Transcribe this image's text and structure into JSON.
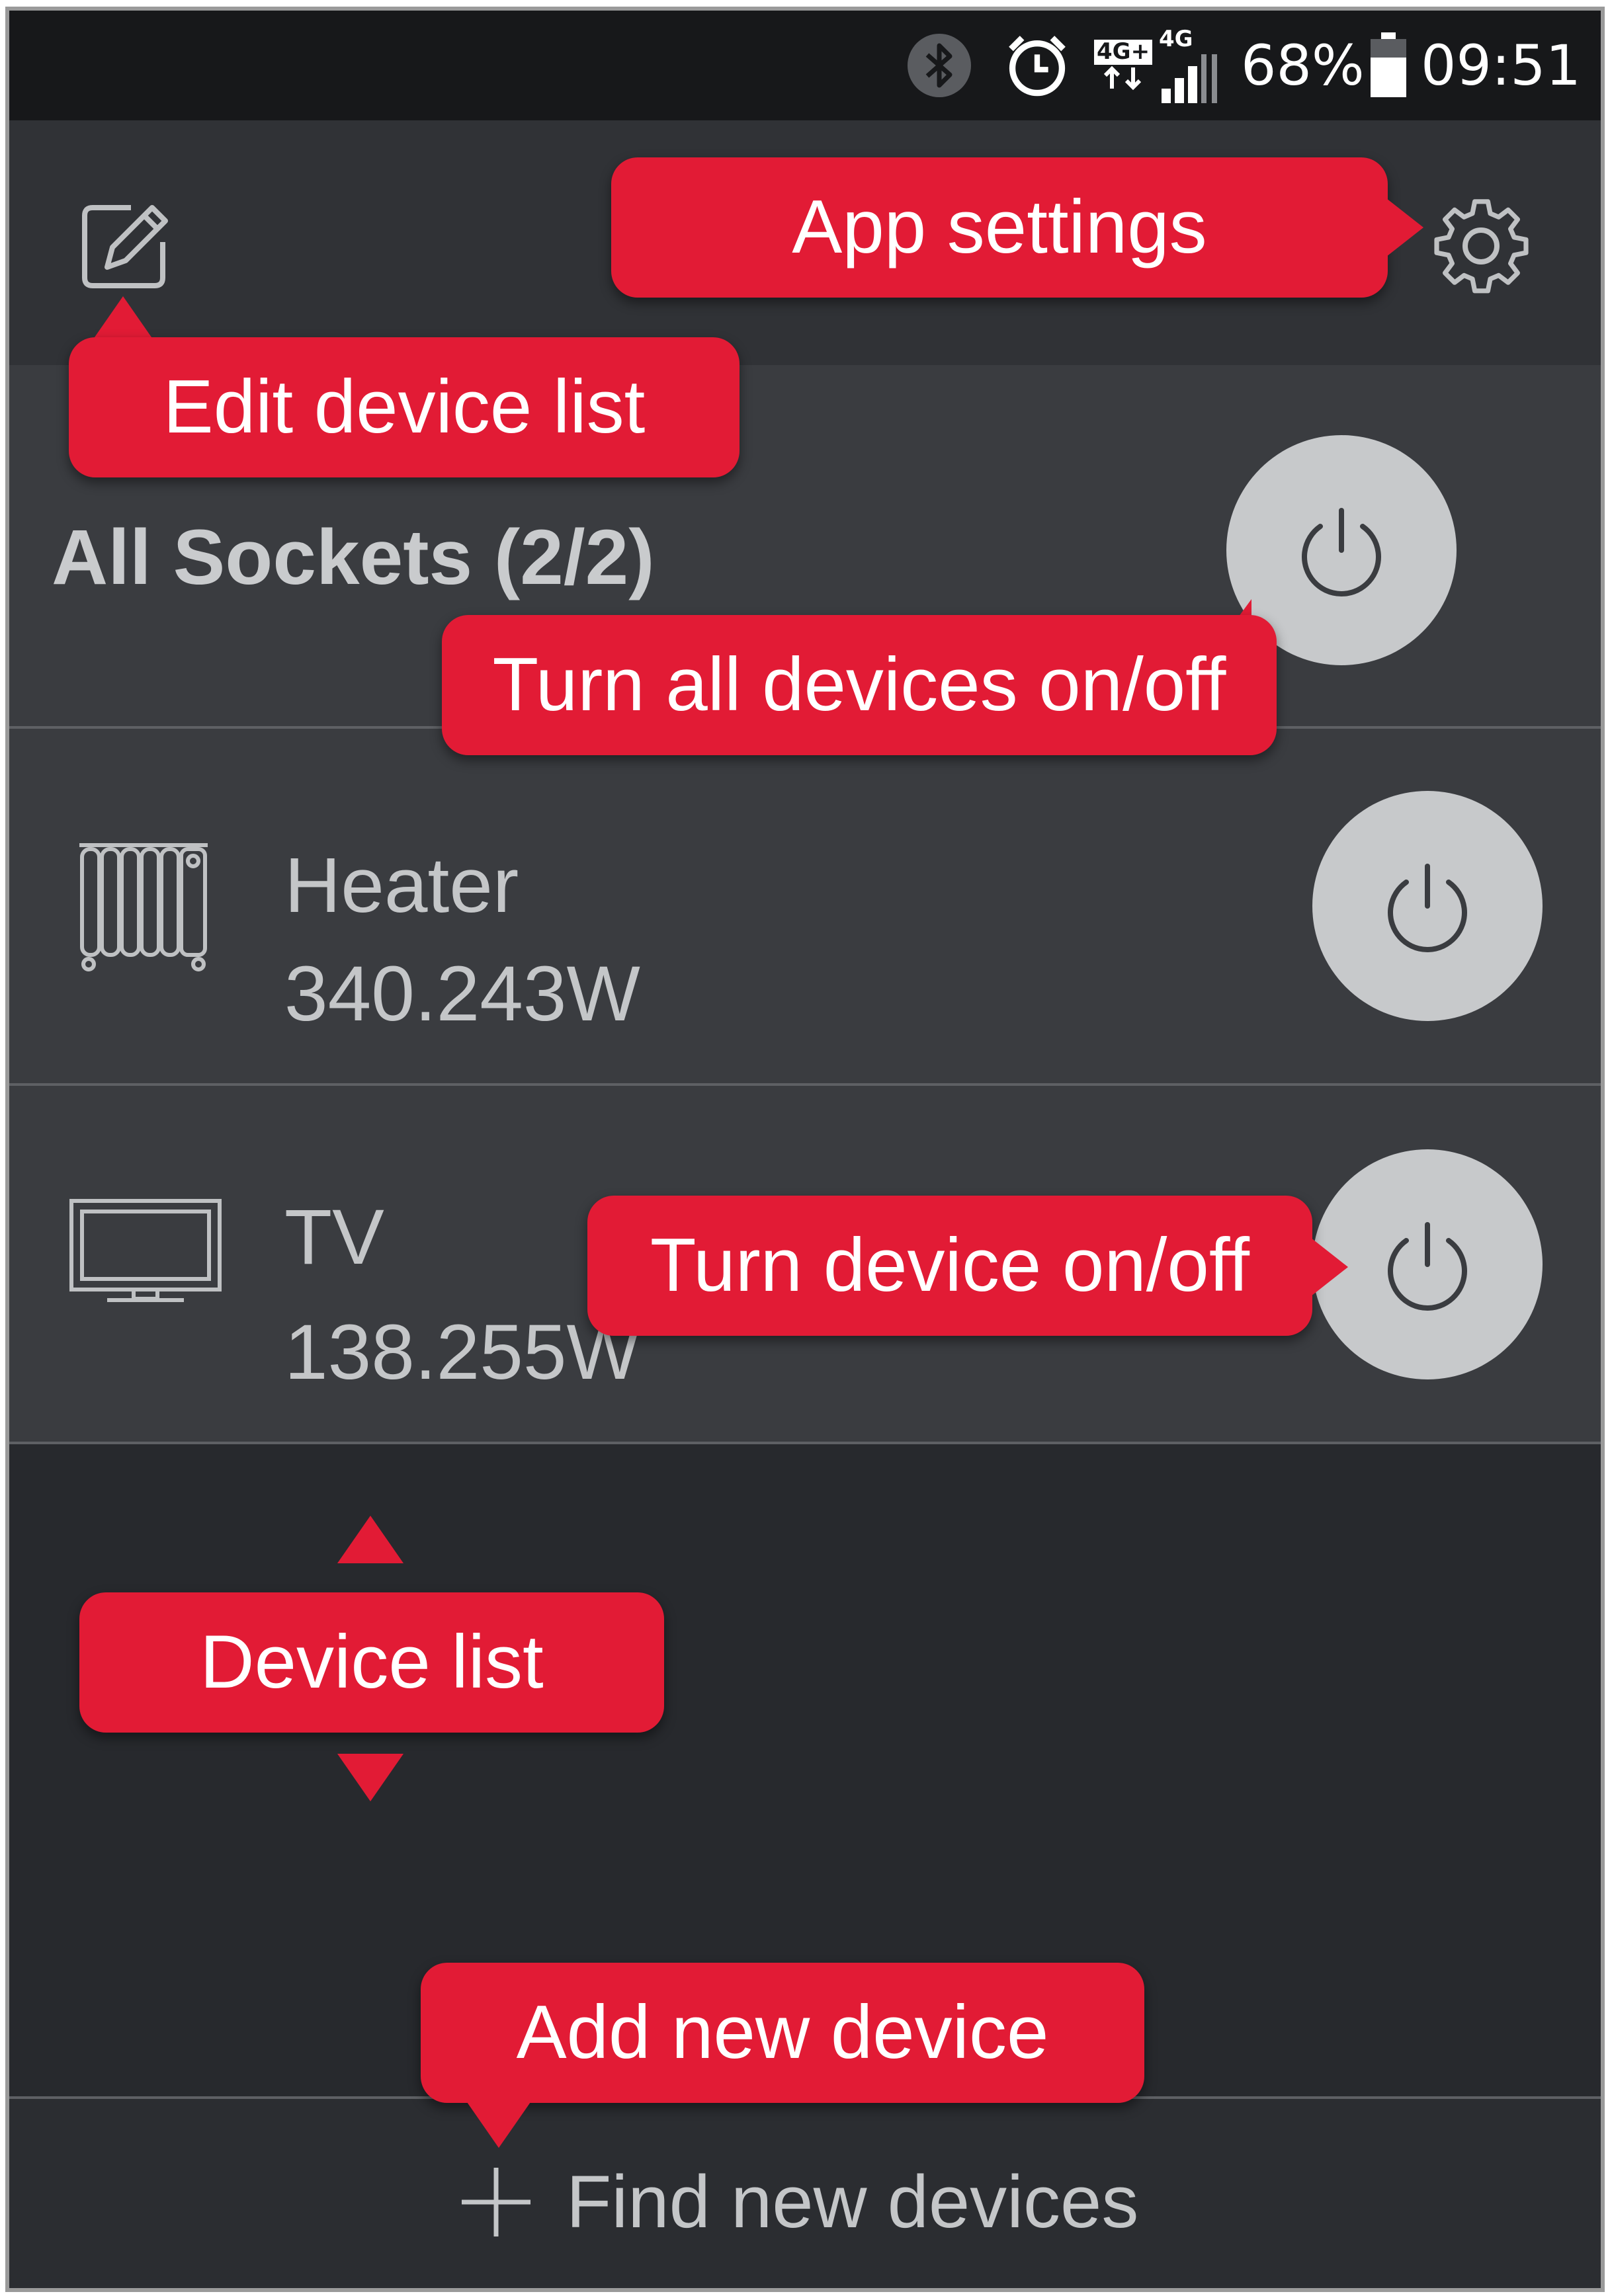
{
  "status_bar": {
    "icons": [
      "bluetooth-icon",
      "alarm-icon",
      "4g-plus-data-icon",
      "4g-signal-icon",
      "battery-icon"
    ],
    "network_left": "4G+",
    "network_right": "4G",
    "battery_percent": "68%",
    "battery_level": 0.68,
    "time": "09:51"
  },
  "app_bar": {
    "left_icon": "edit-icon",
    "right_icon": "gear-icon"
  },
  "all_sockets": {
    "title": "All Sockets (2/2)"
  },
  "devices": [
    {
      "name": "Heater",
      "power": "340.243W",
      "icon": "radiator-icon"
    },
    {
      "name": "TV",
      "power": "138.255W",
      "icon": "tv-icon"
    }
  ],
  "footer": {
    "find_label": "Find new devices",
    "icon": "plus-icon"
  },
  "callouts": {
    "app_settings": "App settings",
    "edit_device_list": "Edit device list",
    "turn_all": "Turn all devices on/off",
    "turn_device": "Turn device on/off",
    "device_list": "Device list",
    "add_new_device": "Add new device"
  },
  "colors": {
    "callout": "#e21b35",
    "status_bar": "#17181a",
    "app_bar": "#303236",
    "row": "#3a3c40",
    "background": "#27292d",
    "power_button": "#c7c9cb"
  }
}
